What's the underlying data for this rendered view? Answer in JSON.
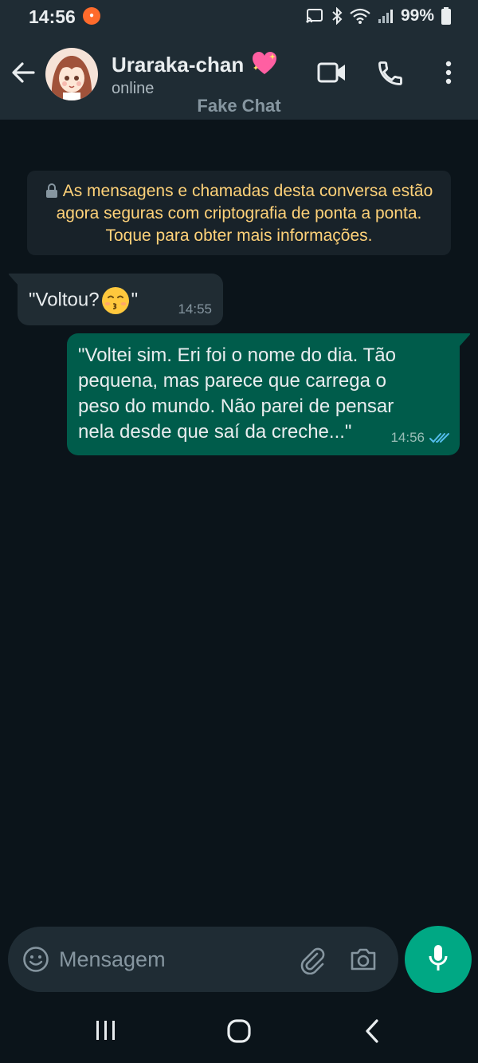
{
  "status_bar": {
    "time": "14:56",
    "battery": "99%",
    "icons": [
      "recording-icon",
      "cast-icon",
      "bluetooth-icon",
      "wifi-icon",
      "signal-icon",
      "battery-icon"
    ]
  },
  "header": {
    "contact_name": "Uraraka-chan",
    "contact_emoji": "💖",
    "status": "online",
    "watermark": "Fake Chat",
    "icons": [
      "back-arrow-icon",
      "avatar",
      "video-call-icon",
      "phone-icon",
      "more-icon"
    ]
  },
  "chat": {
    "encryption_notice": "As mensagens e chamadas desta conversa estão agora seguras com criptografia de ponta a ponta. Toque para obter mais informações.",
    "messages": [
      {
        "direction": "incoming",
        "text_before": "\"Voltou?",
        "emoji": "😙",
        "text_after": "\"",
        "time": "14:55"
      },
      {
        "direction": "outgoing",
        "text": "\"Voltei sim. Eri foi o nome do dia. Tão pequena, mas parece que carrega o peso do mundo. Não parei de pensar nela desde que saí da creche...\"",
        "time": "14:56",
        "status": "read"
      }
    ]
  },
  "composer": {
    "placeholder": "Mensagem",
    "icons": [
      "emoji-icon",
      "attach-icon",
      "camera-icon",
      "mic-icon"
    ]
  },
  "nav_bar": {
    "icons": [
      "recents-icon",
      "home-icon",
      "back-icon"
    ]
  },
  "colors": {
    "background": "#0b141a",
    "bar": "#1f2c34",
    "incoming_bubble": "#202c33",
    "outgoing_bubble": "#005c4b",
    "accent": "#00a884",
    "notice_text": "#ffd279",
    "read_ticks": "#53bdeb"
  }
}
